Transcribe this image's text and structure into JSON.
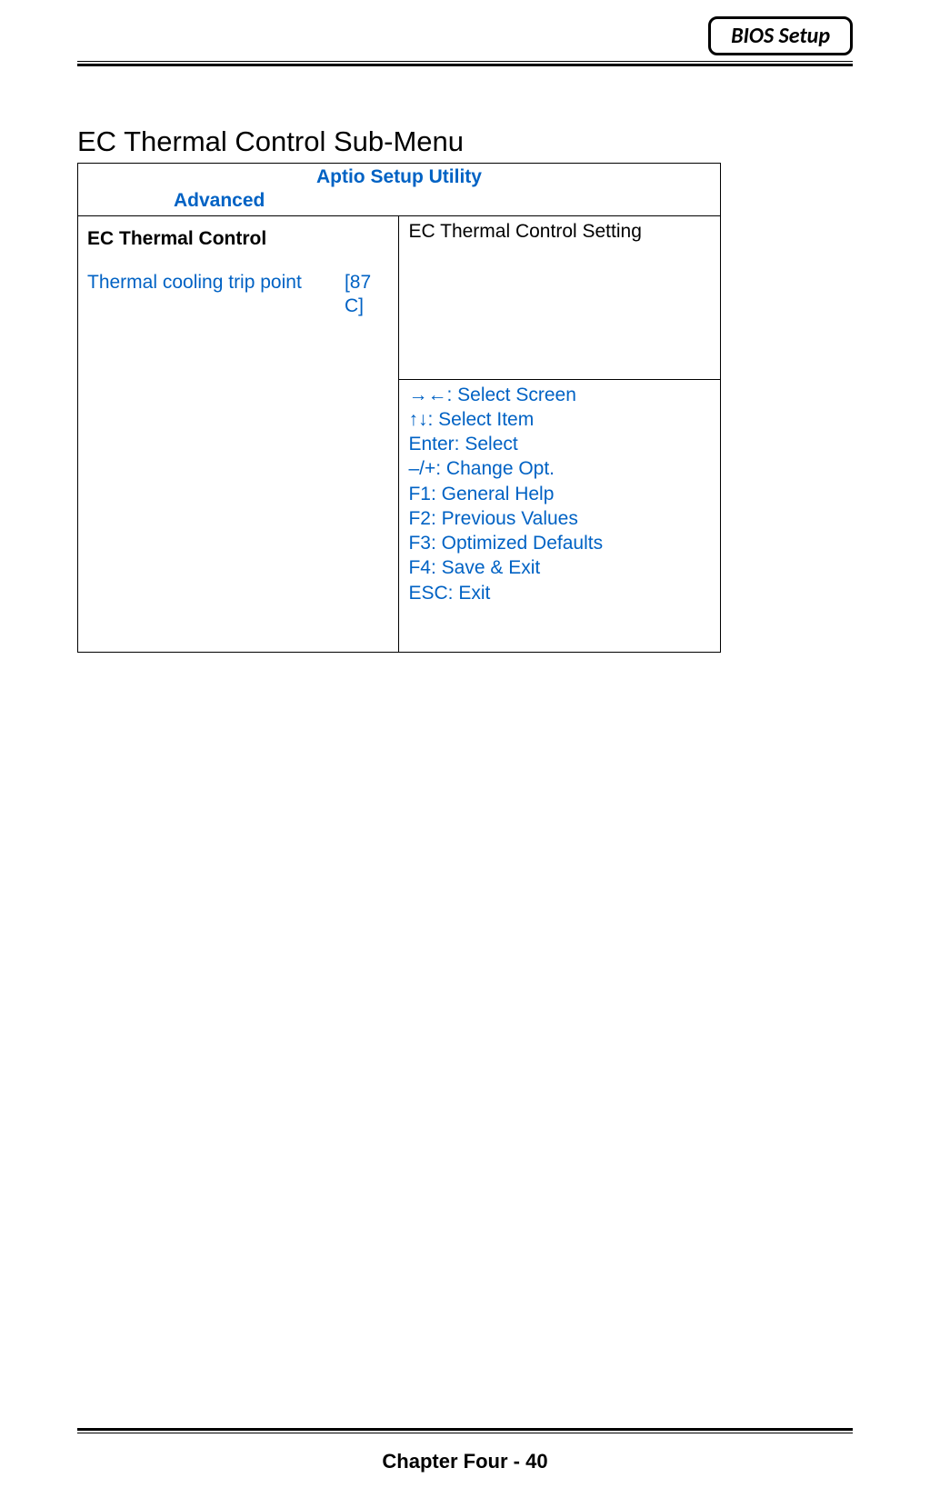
{
  "header": {
    "badge": "BIOS Setup"
  },
  "section_title": "EC Thermal Control Sub-Menu",
  "bios": {
    "utility_title": "Aptio Setup Utility",
    "menu": "Advanced",
    "subhead": "EC Thermal Control",
    "item": {
      "label": "Thermal cooling trip point",
      "value": "[87 C]"
    },
    "help": "EC Thermal Control Setting",
    "nav": [
      "→←: Select Screen",
      "↑↓: Select Item",
      "Enter: Select",
      "–/+: Change Opt.",
      "F1: General Help",
      "F2: Previous Values",
      "F3: Optimized Defaults",
      "F4: Save & Exit",
      "ESC: Exit"
    ]
  },
  "footer": "Chapter Four - 40"
}
